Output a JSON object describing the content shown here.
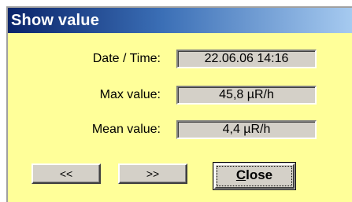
{
  "window": {
    "title": "Show value",
    "background_color": "#ffff99",
    "titlebar_color": "#0a246a"
  },
  "fields": [
    {
      "label": "Date / Time:",
      "value": "22.06.06 14:16"
    },
    {
      "label": "Max value:",
      "value": "45,8 µR/h"
    },
    {
      "label": "Mean value:",
      "value": "4,4 µR/h"
    }
  ],
  "buttons": {
    "prev_label": "<<",
    "next_label": ">>",
    "close_mnemonic": "C",
    "close_rest": "lose"
  }
}
